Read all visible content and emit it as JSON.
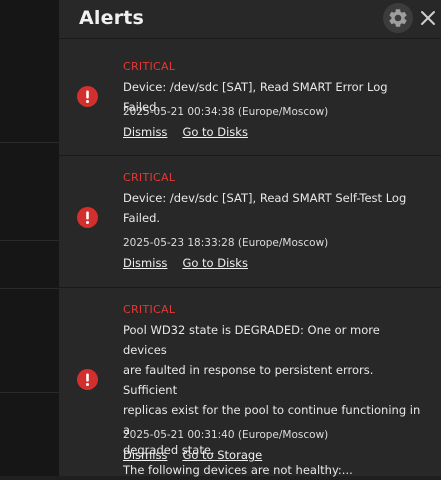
{
  "panel": {
    "title": "Alerts"
  },
  "alerts": [
    {
      "level": "CRITICAL",
      "message_lines": [
        "Device: /dev/sdc [SAT], Read SMART Error Log Failed."
      ],
      "timestamp": "2025-05-21 00:34:38 (Europe/Moscow)",
      "actions": [
        "Dismiss",
        "Go to Disks"
      ]
    },
    {
      "level": "CRITICAL",
      "message_lines": [
        "Device: /dev/sdc [SAT], Read SMART Self-Test Log",
        "Failed."
      ],
      "timestamp": "2025-05-23 18:33:28 (Europe/Moscow)",
      "actions": [
        "Dismiss",
        "Go to Disks"
      ]
    },
    {
      "level": "CRITICAL",
      "message_lines": [
        "Pool WD32 state is DEGRADED: One or more devices",
        "are faulted in response to persistent errors. Sufficient",
        "replicas exist for the pool to continue functioning in a",
        "degraded state.",
        "The following devices are not healthy:..."
      ],
      "timestamp": "2025-05-21 00:31:40 (Europe/Moscow)",
      "actions": [
        "Dismiss",
        "Go to Storage"
      ]
    }
  ],
  "icons": {
    "settings": "gear-icon",
    "close": "close-icon",
    "alert": "error-icon"
  },
  "colors": {
    "critical": "#e53935",
    "icon_bg": "#d32f2f",
    "panel_bg": "#282828"
  }
}
